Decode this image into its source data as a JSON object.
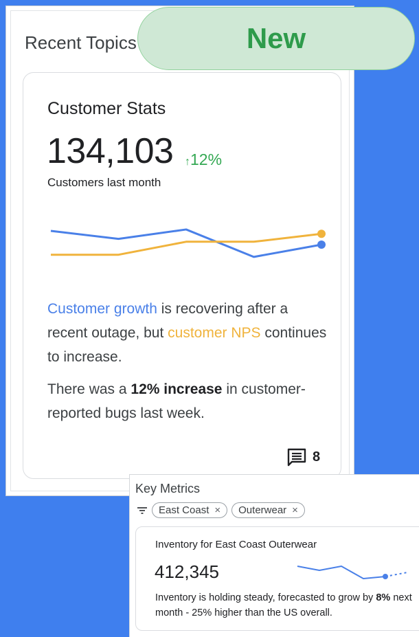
{
  "recent_topics": {
    "title": "Recent Topics",
    "card": {
      "title": "Customer Stats",
      "value": "134,103",
      "delta_arrow": "↑",
      "delta": "12%",
      "subtitle": "Customers last month",
      "chart_data": {
        "type": "line",
        "x": [
          1,
          2,
          3,
          4,
          5
        ],
        "series": [
          {
            "values": [
              59,
              48,
              61,
              23,
              40
            ],
            "color": "#4a80e8"
          },
          {
            "values": [
              26,
              26,
              44,
              44,
              55
            ],
            "color": "#f0b33c"
          }
        ],
        "ylim": [
          0,
          80
        ],
        "grid": false
      },
      "para1": {
        "part1": "Customer growth",
        "part2": " is recovering after a recent outage, but ",
        "part3": "customer NPS",
        "part4": " continues to increase."
      },
      "para2": {
        "part1": "There was a ",
        "part2": "12% increase",
        "part3": " in customer-reported bugs last week."
      },
      "comment_icon": "comment-icon",
      "comment_count": "8"
    }
  },
  "badge": {
    "label": "New",
    "color": "#2e9b4b"
  },
  "key_metrics": {
    "title": "Key Metrics",
    "filter_icon": "filter-icon",
    "chips": [
      {
        "label": "East Coast",
        "remove": "×"
      },
      {
        "label": "Outerwear",
        "remove": "×"
      }
    ],
    "card": {
      "title": "Inventory for East Coast Outerwear",
      "value": "412,345",
      "text_part1": "Inventory is holding steady, forecasted to grow by ",
      "text_bold": "8%",
      "text_part2": " next month - 25% higher than the US overall.",
      "chart_data": {
        "type": "line",
        "x": [
          1,
          2,
          3,
          4,
          5,
          6
        ],
        "series": [
          {
            "values": [
              8,
              6,
              8,
              2,
              3,
              5
            ],
            "color": "#4a80e8",
            "forecast_from_index": 4
          }
        ],
        "ylim": [
          0,
          10
        ]
      }
    }
  }
}
